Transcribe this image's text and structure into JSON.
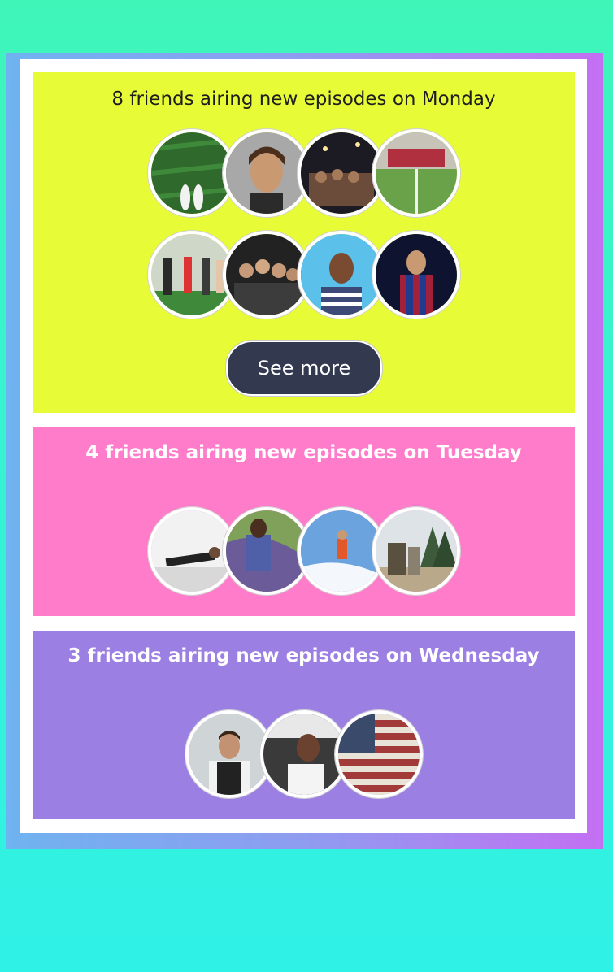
{
  "sections": [
    {
      "heading": "8 friends airing new episodes on Monday",
      "button_label": "See more"
    },
    {
      "heading": "4 friends airing new episodes on Tuesday"
    },
    {
      "heading": "3 friends airing new episodes on Wednesday"
    }
  ],
  "colors": {
    "monday": "#e8fb37",
    "tuesday": "#ff7ccb",
    "wednesday": "#9b7fe3",
    "button": "#333a50"
  }
}
